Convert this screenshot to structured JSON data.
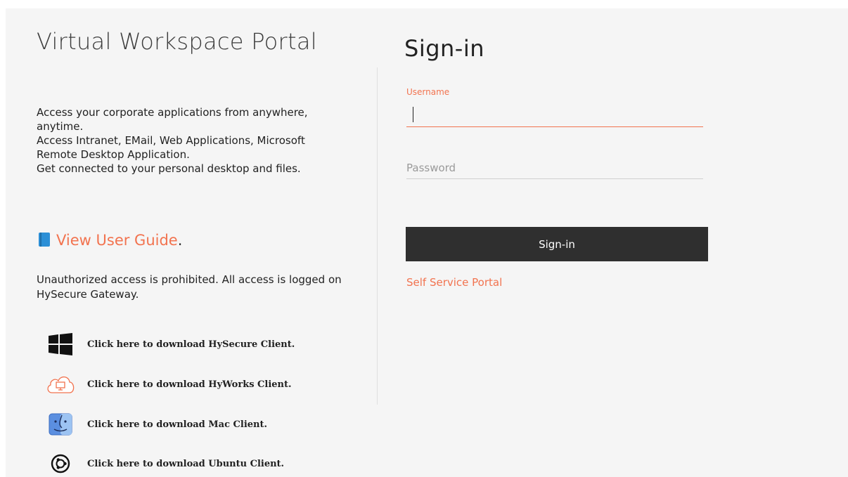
{
  "portal": {
    "title": "Virtual Workspace Portal",
    "description_lines": [
      "Access your corporate applications from anywhere,",
      "anytime.",
      "Access Intranet, EMail, Web Applications, Microsoft",
      "Remote Desktop Application.",
      "Get connected to your personal desktop and files."
    ],
    "user_guide_label": "View User Guide",
    "user_guide_suffix": ".",
    "warning_text": "Unauthorized access is prohibited. All access is logged on HySecure Gateway.",
    "downloads": [
      {
        "label": "Click here to download HySecure Client.",
        "icon": "windows-icon"
      },
      {
        "label": "Click here to download HyWorks Client.",
        "icon": "cloud-desktop-icon"
      },
      {
        "label": "Click here to download Mac Client.",
        "icon": "mac-finder-icon"
      },
      {
        "label": "Click here to download Ubuntu Client.",
        "icon": "ubuntu-icon"
      }
    ]
  },
  "signin": {
    "title": "Sign-in",
    "username_label": "Username",
    "username_value": "",
    "password_placeholder": "Password",
    "button_label": "Sign-in",
    "self_service_label": "Self Service Portal"
  },
  "colors": {
    "accent": "#f2734f",
    "button_bg": "#2f2f2f",
    "panel_bg": "#f5f5f5"
  }
}
